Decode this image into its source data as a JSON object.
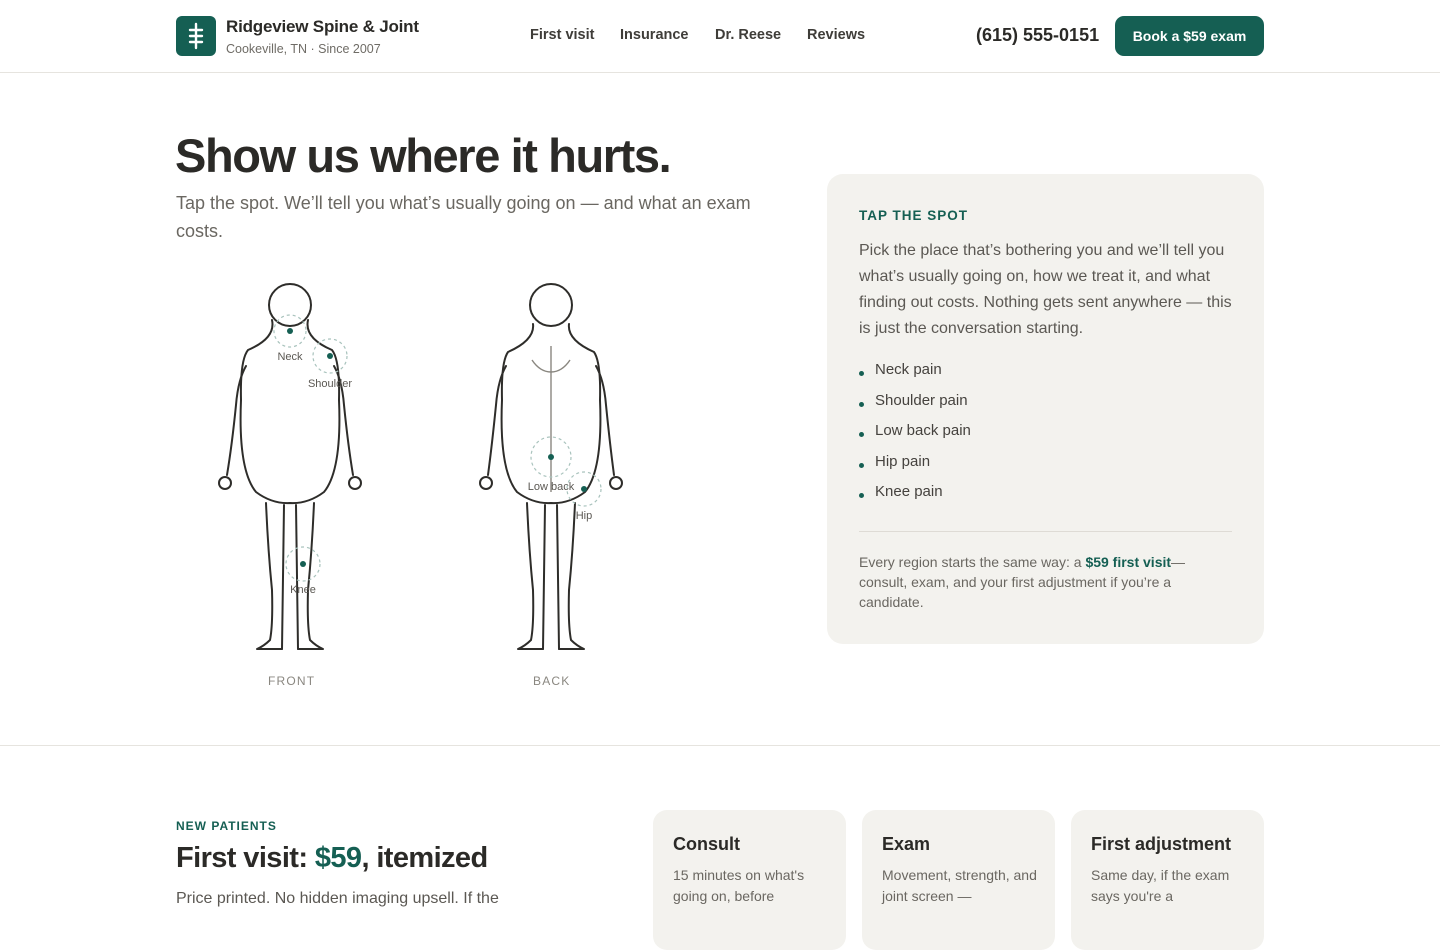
{
  "header": {
    "brand_name": "Ridgeview Spine & Joint",
    "brand_sub": "Cookeville, TN · Since 2007",
    "nav": [
      "First visit",
      "Insurance",
      "Dr. Reese",
      "Reviews"
    ],
    "phone": "(615) 555-0151",
    "cta": "Book a $59 exam"
  },
  "hero": {
    "title": "Show us where it hurts.",
    "subtitle": "Tap the spot. We’ll tell you what’s usually going on — and what an exam costs."
  },
  "diagram": {
    "hotspots": {
      "neck": "Neck",
      "shoulder": "Shoulder",
      "knee": "Knee",
      "low_back": "Low back",
      "hip": "Hip"
    },
    "front_label": "FRONT",
    "back_label": "BACK"
  },
  "panel": {
    "eyebrow": "TAP THE SPOT",
    "text": "Pick the place that’s bothering you and we’ll tell you what’s usually going on, how we treat it, and what finding out costs. Nothing gets sent anywhere — this is just the conversation starting.",
    "regions": [
      "Neck pain",
      "Shoulder pain",
      "Low back pain",
      "Hip pain",
      "Knee pain"
    ],
    "note_before": "Every region starts the same way: a ",
    "note_accent": "$59 first visit",
    "note_after": "—consult, exam, and your first adjustment if you’re a candidate."
  },
  "new_patients": {
    "eyebrow": "NEW PATIENTS",
    "title_before": "First visit: ",
    "title_price": "$59",
    "title_after": ", itemized",
    "description": "Price printed. No hidden imaging upsell. If the",
    "cards": [
      {
        "title": "Consult",
        "text": "15 minutes on what's going on, before"
      },
      {
        "title": "Exam",
        "text": "Movement, strength, and joint screen —"
      },
      {
        "title": "First adjustment",
        "text": "Same day, if the exam says you're a"
      }
    ]
  },
  "colors": {
    "accent": "#155f53",
    "panel_bg": "#f3f2ee",
    "text": "#2b2a27"
  }
}
